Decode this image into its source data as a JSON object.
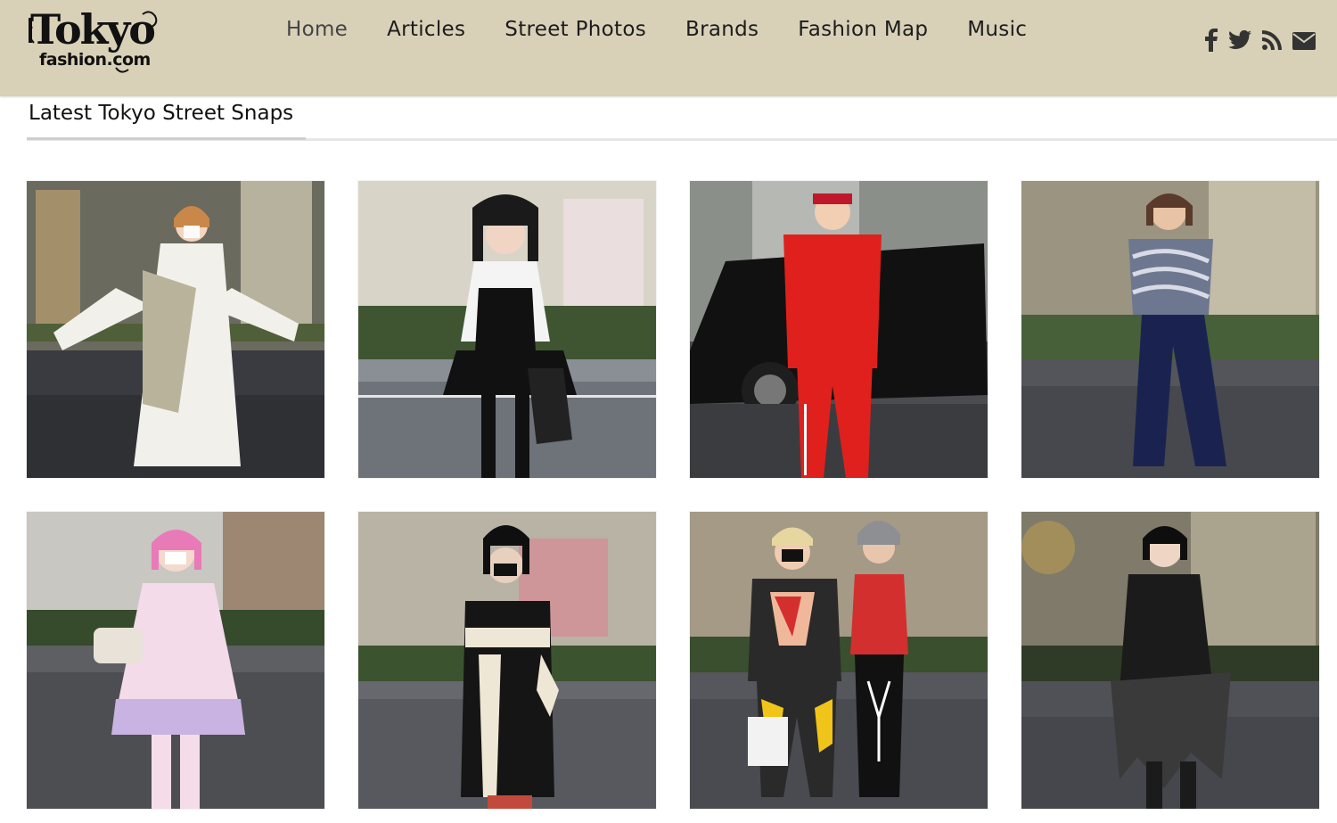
{
  "site": {
    "logo_main": "Tokyo",
    "logo_sub": "fashion.com"
  },
  "nav": [
    {
      "label": "Home"
    },
    {
      "label": "Articles"
    },
    {
      "label": "Street Photos"
    },
    {
      "label": "Brands"
    },
    {
      "label": "Fashion Map"
    },
    {
      "label": "Music"
    }
  ],
  "social": [
    "facebook-icon",
    "twitter-icon",
    "rss-icon",
    "email-icon"
  ],
  "section": {
    "title": "Latest Tokyo Street Snaps"
  },
  "colors": {
    "header_bg": "#d8d1b8",
    "nav_text": "#1c1c1c",
    "page_bg": "#ffffff"
  },
  "photos": [
    {
      "subject": "white-robe-outfit",
      "palette": [
        "#f2f0ea",
        "#b8b39a",
        "#c9874a"
      ]
    },
    {
      "subject": "gothic-lolita-outfit",
      "palette": [
        "#111111",
        "#f4f4f4",
        "#2b2b2b"
      ]
    },
    {
      "subject": "red-suit-outfit",
      "palette": [
        "#e0201c",
        "#111111",
        "#c8c8c8"
      ]
    },
    {
      "subject": "striped-sweater-velvet-pants",
      "palette": [
        "#6e7790",
        "#1a2350",
        "#5a3a2a"
      ]
    },
    {
      "subject": "pastel-lolita-outfit",
      "palette": [
        "#f3dbe9",
        "#c9b3e2",
        "#e97ab8"
      ]
    },
    {
      "subject": "black-kimono-outfit",
      "palette": [
        "#151515",
        "#efe7d6",
        "#c24a3c"
      ]
    },
    {
      "subject": "two-person-streetwear",
      "palette": [
        "#2a2a2a",
        "#d32f2f",
        "#f0c419"
      ]
    },
    {
      "subject": "black-layered-dress",
      "palette": [
        "#1b1b1b",
        "#3a3a3a",
        "#c6a24a"
      ]
    }
  ]
}
